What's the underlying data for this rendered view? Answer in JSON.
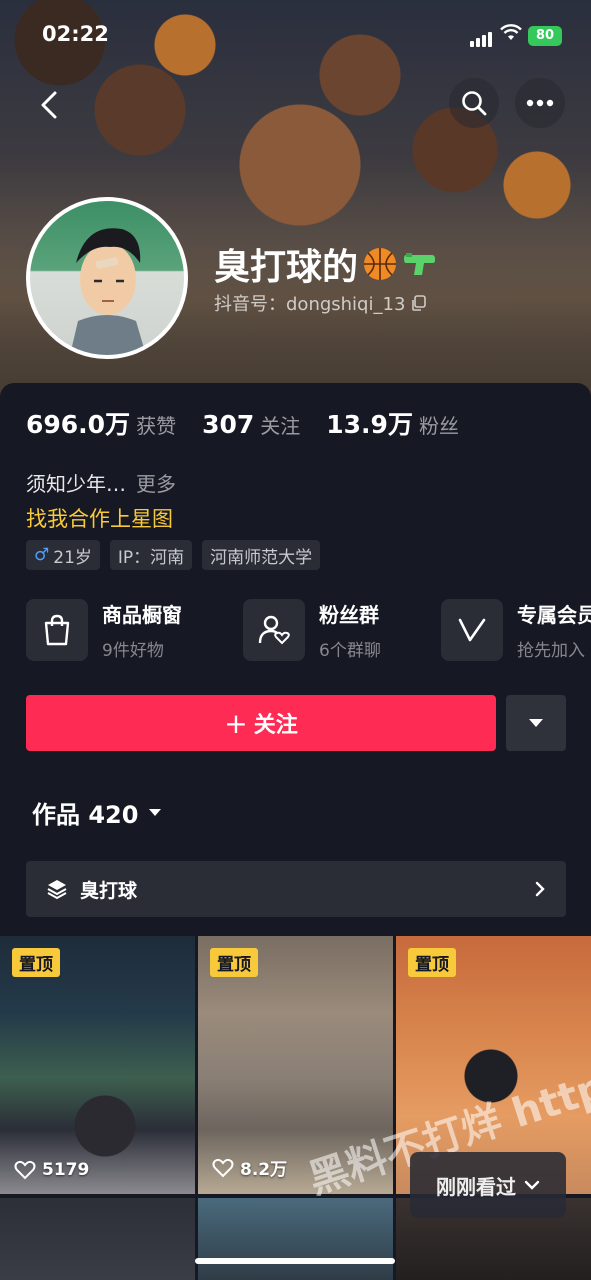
{
  "status_bar": {
    "time": "02:22",
    "battery": "80"
  },
  "profile": {
    "nickname": "臭打球的",
    "douyin_id": "抖音号：dongshiqi_13",
    "stats": [
      {
        "value": "696.0万",
        "label": "获赞"
      },
      {
        "value": "307",
        "label": "关注"
      },
      {
        "value": "13.9万",
        "label": "粉丝"
      }
    ],
    "bio": "须知少年…",
    "bio_more": "更多",
    "cooperate": "找我合作上星图",
    "tags": {
      "age": "21岁",
      "gender_symbol": "♂",
      "ip": "IP：河南",
      "school": "河南师范大学"
    }
  },
  "services": [
    {
      "title": "商品橱窗",
      "subtitle": "9件好物",
      "icon": "shopping-bag-icon"
    },
    {
      "title": "粉丝群",
      "subtitle": "6个群聊",
      "icon": "fan-group-icon"
    },
    {
      "title": "专属会员",
      "subtitle": "抢先加入",
      "icon": "vip-icon"
    }
  ],
  "actions": {
    "follow": "关注",
    "follow_plus": "+"
  },
  "works": {
    "label": "作品 420"
  },
  "collection": {
    "label": "臭打球"
  },
  "videos": [
    {
      "pinned": "置顶",
      "likes": "5179"
    },
    {
      "pinned": "置顶",
      "likes": "8.2万"
    },
    {
      "pinned": "置顶",
      "likes": ""
    }
  ],
  "recent": {
    "label": "刚刚看过"
  },
  "watermark": "黑料不打烊 https://bdye.co",
  "colors": {
    "accent": "#fe2c55",
    "highlight": "#f8c93a",
    "background": "#161823"
  }
}
